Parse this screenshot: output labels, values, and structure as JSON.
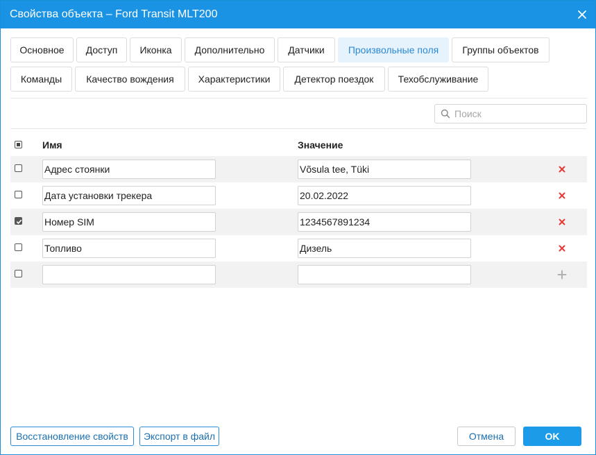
{
  "dialog": {
    "title": "Свойства объекта – Ford Transit MLT200"
  },
  "tabs": [
    {
      "label": "Основное",
      "active": false
    },
    {
      "label": "Доступ",
      "active": false
    },
    {
      "label": "Иконка",
      "active": false
    },
    {
      "label": "Дополнительно",
      "active": false
    },
    {
      "label": "Датчики",
      "active": false
    },
    {
      "label": "Произвольные поля",
      "active": true
    },
    {
      "label": "Группы объектов",
      "active": false
    },
    {
      "label": "Команды",
      "active": false
    },
    {
      "label": "Качество вождения",
      "active": false
    },
    {
      "label": "Характеристики",
      "active": false
    },
    {
      "label": "Детектор поездок",
      "active": false
    },
    {
      "label": "Техобслуживание",
      "active": false
    }
  ],
  "search": {
    "placeholder": "Поиск",
    "value": ""
  },
  "table": {
    "headers": {
      "name": "Имя",
      "value": "Значение"
    },
    "select_all_state": "partial",
    "rows": [
      {
        "checked": false,
        "name": "Адрес стоянки",
        "value": "Võsula tee, Tüki",
        "action": "delete-icon"
      },
      {
        "checked": false,
        "name": "Дата установки трекера",
        "value": "20.02.2022",
        "action": "delete-icon"
      },
      {
        "checked": true,
        "name": "Номер SIM",
        "value": "1234567891234",
        "action": "delete-icon"
      },
      {
        "checked": false,
        "name": "Топливо",
        "value": "Дизель",
        "action": "delete-icon"
      },
      {
        "checked": false,
        "name": "",
        "value": "",
        "action": "add-icon"
      }
    ]
  },
  "footer": {
    "restore_label": "Восстановление свойств",
    "export_label": "Экспорт в файл",
    "cancel_label": "Отмена",
    "ok_label": "OK"
  },
  "colors": {
    "accent": "#1b93e4",
    "delete": "#e53935",
    "add": "#b0b0b0",
    "active_tab_bg": "#e6f2fc",
    "active_tab_text": "#2b8ad6"
  }
}
